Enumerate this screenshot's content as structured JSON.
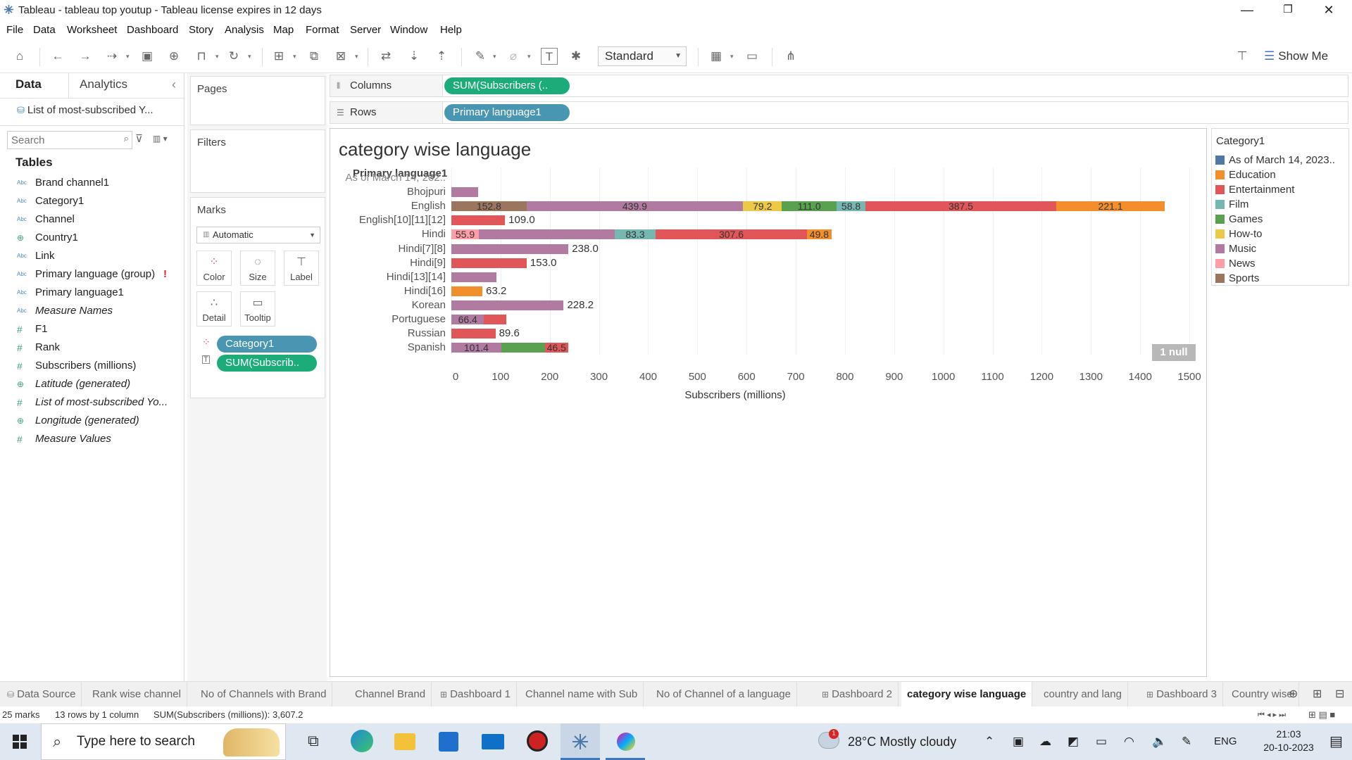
{
  "window": {
    "title": "Tableau - tableau top youtup - Tableau license expires in 12 days",
    "minimize": "—",
    "restore": "❐",
    "close": "✕"
  },
  "menu": [
    "File",
    "Data",
    "Worksheet",
    "Dashboard",
    "Story",
    "Analysis",
    "Map",
    "Format",
    "Server",
    "Window",
    "Help"
  ],
  "toolbar": {
    "fit_mode": "Standard",
    "show_me": "Show Me"
  },
  "data_pane": {
    "tab_data": "Data",
    "tab_analytics": "Analytics",
    "collapse": "‹",
    "datasource": "List of most-subscribed Y...",
    "search_placeholder": "Search",
    "tables_header": "Tables",
    "fields": [
      {
        "type": "Abc",
        "name": "Brand channel1"
      },
      {
        "type": "Abc",
        "name": "Category1"
      },
      {
        "type": "Abc",
        "name": "Channel"
      },
      {
        "type": "⊕",
        "name": "Country1"
      },
      {
        "type": "Abc",
        "name": "Link"
      },
      {
        "type": "Abc",
        "name": "Primary language (group)",
        "warn": "!"
      },
      {
        "type": "Abc",
        "name": "Primary language1"
      },
      {
        "type": "Abc",
        "name": "Measure Names"
      },
      {
        "type": "#",
        "name": "F1"
      },
      {
        "type": "#",
        "name": "Rank"
      },
      {
        "type": "#",
        "name": "Subscribers (millions)"
      },
      {
        "type": "⊕",
        "name": "Latitude (generated)"
      },
      {
        "type": "#",
        "name": "List of most-subscribed Yo..."
      },
      {
        "type": "⊕",
        "name": "Longitude (generated)"
      },
      {
        "type": "#",
        "name": "Measure Values"
      }
    ]
  },
  "shelves": {
    "pages": "Pages",
    "filters": "Filters",
    "marks": "Marks",
    "mark_type": "Automatic",
    "mark_buttons": [
      "Color",
      "Size",
      "Label",
      "Detail",
      "Tooltip"
    ],
    "marks_pills": [
      "Category1",
      "SUM(Subscrib.."
    ],
    "columns_label": "Columns",
    "columns_pill": "SUM(Subscribers (..",
    "rows_label": "Rows",
    "rows_pill": "Primary language1"
  },
  "viz": {
    "null_badge": "1 null",
    "row_header": "Primary language1"
  },
  "legend": {
    "title": "Category1",
    "items": [
      {
        "name": "As of March 14, 2023..",
        "color": "#4e79a7"
      },
      {
        "name": "Education",
        "color": "#f28e2b"
      },
      {
        "name": "Entertainment",
        "color": "#e15759"
      },
      {
        "name": "Film",
        "color": "#76b7b2"
      },
      {
        "name": "Games",
        "color": "#59a14f"
      },
      {
        "name": "How-to",
        "color": "#edc948"
      },
      {
        "name": "Music",
        "color": "#b07aa1"
      },
      {
        "name": "News",
        "color": "#ff9da7"
      },
      {
        "name": "Sports",
        "color": "#9c755f"
      }
    ]
  },
  "chart_data": {
    "type": "bar",
    "orientation": "horizontal-stacked",
    "title": "category wise language",
    "xlabel": "Subscribers (millions)",
    "ylabel": "Primary language1",
    "xlim": [
      0,
      1500
    ],
    "xticks": [
      0,
      100,
      200,
      300,
      400,
      500,
      600,
      700,
      800,
      900,
      1000,
      1100,
      1200,
      1300,
      1400,
      1500
    ],
    "rows": [
      {
        "label": "As of March 14, 202..",
        "segments": []
      },
      {
        "label": "Bhojpuri",
        "segments": [
          {
            "category": "Music",
            "value": 55
          }
        ]
      },
      {
        "label": "English",
        "segments": [
          {
            "category": "Sports",
            "value": 152.8,
            "label": "152.8"
          },
          {
            "category": "Music",
            "value": 439.9,
            "label": "439.9"
          },
          {
            "category": "How-to",
            "value": 79.2,
            "label": "79.2"
          },
          {
            "category": "Games",
            "value": 111.0,
            "label": "111.0"
          },
          {
            "category": "Film",
            "value": 58.8,
            "label": "58.8"
          },
          {
            "category": "Entertainment",
            "value": 387.5,
            "label": "387.5"
          },
          {
            "category": "Education",
            "value": 221.1,
            "label": "221.1"
          }
        ]
      },
      {
        "label": "English[10][11][12]",
        "segments": [
          {
            "category": "Entertainment",
            "value": 109.0
          }
        ],
        "end_label": "109.0"
      },
      {
        "label": "Hindi",
        "segments": [
          {
            "category": "News",
            "value": 55.9,
            "label": "55.9"
          },
          {
            "category": "Music",
            "value": 276.0
          },
          {
            "category": "Film",
            "value": 83.3,
            "label": "83.3"
          },
          {
            "category": "Entertainment",
            "value": 307.6,
            "label": "307.6"
          },
          {
            "category": "Education",
            "value": 49.8,
            "label": "49.8"
          }
        ]
      },
      {
        "label": "Hindi[7][8]",
        "segments": [
          {
            "category": "Music",
            "value": 238.0
          }
        ],
        "end_label": "238.0"
      },
      {
        "label": "Hindi[9]",
        "segments": [
          {
            "category": "Entertainment",
            "value": 153.0
          }
        ],
        "end_label": "153.0"
      },
      {
        "label": "Hindi[13][14]",
        "segments": [
          {
            "category": "Music",
            "value": 92
          }
        ]
      },
      {
        "label": "Hindi[16]",
        "segments": [
          {
            "category": "Education",
            "value": 63.2
          }
        ],
        "end_label": "63.2"
      },
      {
        "label": "Korean",
        "segments": [
          {
            "category": "Music",
            "value": 228.2
          }
        ],
        "end_label": "228.2"
      },
      {
        "label": "Portuguese",
        "segments": [
          {
            "category": "Music",
            "value": 66.4,
            "label": "66.4"
          },
          {
            "category": "Entertainment",
            "value": 45
          }
        ]
      },
      {
        "label": "Russian",
        "segments": [
          {
            "category": "Entertainment",
            "value": 89.6
          }
        ],
        "end_label": "89.6"
      },
      {
        "label": "Spanish",
        "segments": [
          {
            "category": "Music",
            "value": 101.4,
            "label": "101.4"
          },
          {
            "category": "Games",
            "value": 89
          },
          {
            "category": "Entertainment",
            "value": 46.5,
            "label": "46.5"
          }
        ]
      }
    ]
  },
  "sheet_tabs": [
    {
      "label": "Data Source",
      "icon": "⛁"
    },
    {
      "label": "Rank wise channel"
    },
    {
      "label": "No of Channels with Brand"
    },
    {
      "label": "Channel Brand"
    },
    {
      "label": "Dashboard 1",
      "icon": "⊞"
    },
    {
      "label": "Channel name with Sub"
    },
    {
      "label": "No of Channel of a language"
    },
    {
      "label": "Dashboard 2",
      "icon": "⊞"
    },
    {
      "label": "category wise language",
      "active": true
    },
    {
      "label": "country and lang"
    },
    {
      "label": "Dashboard 3",
      "icon": "⊞"
    },
    {
      "label": "Country wise"
    }
  ],
  "status": {
    "marks": "25 marks",
    "dims": "13 rows by 1 column",
    "sum": "SUM(Subscribers (millions)): 3,607.2"
  },
  "taskbar": {
    "search_placeholder": "Type here to search",
    "weather": "28°C  Mostly cloudy",
    "lang": "ENG",
    "time": "21:03",
    "date": "20-10-2023",
    "notif_count": "1"
  }
}
